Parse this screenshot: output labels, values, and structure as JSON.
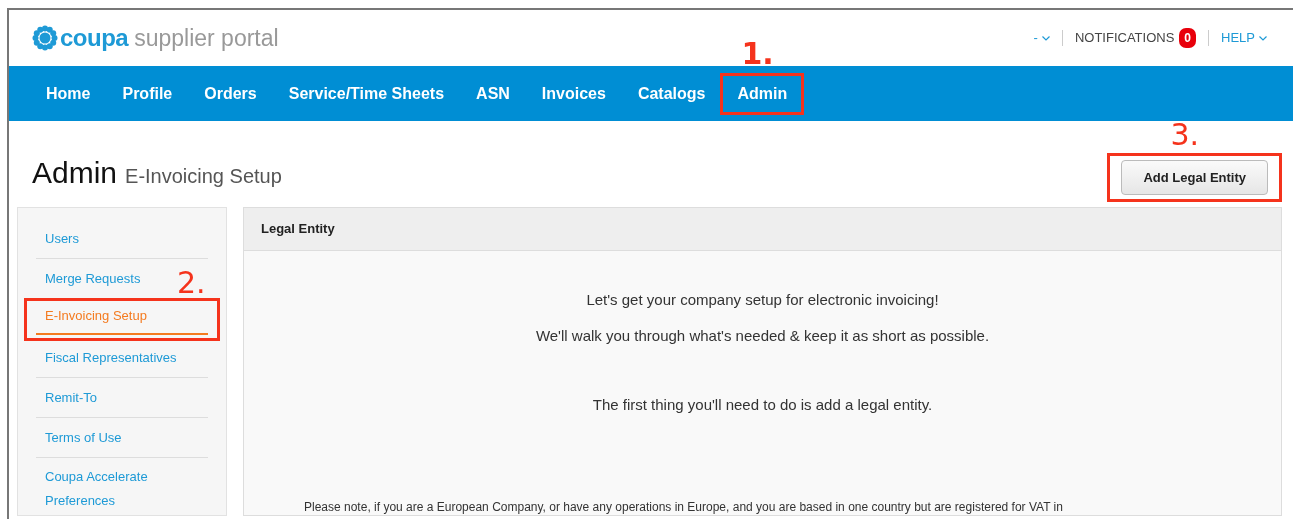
{
  "header": {
    "logo_brand": "coupa",
    "logo_product": "supplier portal",
    "user_menu": "-",
    "notifications": {
      "label": "NOTIFICATIONS",
      "count": "0"
    },
    "help": "HELP"
  },
  "nav": [
    {
      "label": "Home"
    },
    {
      "label": "Profile"
    },
    {
      "label": "Orders"
    },
    {
      "label": "Service/Time Sheets"
    },
    {
      "label": "ASN"
    },
    {
      "label": "Invoices"
    },
    {
      "label": "Catalogs"
    },
    {
      "label": "Admin",
      "callout": "1."
    }
  ],
  "page": {
    "title": "Admin",
    "subtitle": "E-Invoicing Setup",
    "action": {
      "label": "Add Legal Entity",
      "callout": "3."
    }
  },
  "sidebar": [
    {
      "label": "Users",
      "selected": false
    },
    {
      "label": "Merge Requests",
      "selected": false
    },
    {
      "label": "E-Invoicing Setup",
      "selected": true,
      "callout": "2."
    },
    {
      "label": "Fiscal Representatives",
      "selected": false
    },
    {
      "label": "Remit-To",
      "selected": false
    },
    {
      "label": "Terms of Use",
      "selected": false
    },
    {
      "label": "Coupa Accelerate Preferences",
      "selected": false
    }
  ],
  "panel": {
    "title": "Legal Entity",
    "intro": [
      "Let's get your company setup for electronic invoicing!",
      "We'll walk you through what's needed & keep it as short as possible."
    ],
    "instruction": "The first thing you'll need to do is add a legal entity.",
    "note": "Please note, if you are a European Company, or have any operations in Europe, and you are based in one country but are registered for VAT in"
  }
}
